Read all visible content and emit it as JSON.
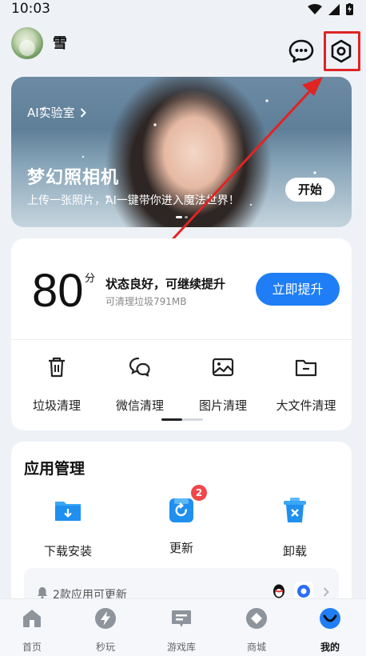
{
  "status_bar": {
    "time": "10:03"
  },
  "header": {
    "username": "雪",
    "chat_icon": "chat-bubble-icon",
    "settings_icon": "settings-icon"
  },
  "banner": {
    "lab_label": "AI实验室",
    "title": "梦幻照相机",
    "subtitle": "上传一张照片，AI一键带你进入魔法世界！",
    "button_label": "开始"
  },
  "score_card": {
    "score": "80",
    "unit": "分",
    "status": "状态良好，可继续提升",
    "junk_text": "可清理垃圾791MB",
    "boost_button": "立即提升",
    "tools": [
      {
        "label": "垃圾清理",
        "icon": "trash-icon"
      },
      {
        "label": "微信清理",
        "icon": "wechat-icon"
      },
      {
        "label": "图片清理",
        "icon": "image-icon"
      },
      {
        "label": "大文件清理",
        "icon": "folder-icon"
      }
    ]
  },
  "app_management": {
    "title": "应用管理",
    "items": [
      {
        "label": "下载安装",
        "icon": "download-folder-icon"
      },
      {
        "label": "更新",
        "icon": "update-icon",
        "badge": "2"
      },
      {
        "label": "卸载",
        "icon": "uninstall-icon"
      }
    ],
    "update_notice": "2款应用可更新"
  },
  "bottom_nav": [
    {
      "label": "首页",
      "icon": "home-icon"
    },
    {
      "label": "秒玩",
      "icon": "lightning-icon"
    },
    {
      "label": "游戏库",
      "icon": "game-library-icon"
    },
    {
      "label": "商城",
      "icon": "store-icon"
    },
    {
      "label": "我的",
      "icon": "profile-icon",
      "active": true
    }
  ],
  "colors": {
    "accent": "#1f7ef5",
    "badge": "#f0474a",
    "highlight": "#e02424"
  }
}
